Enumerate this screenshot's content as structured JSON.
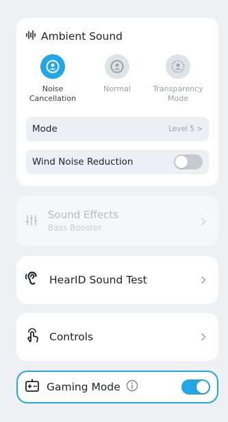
{
  "ambient": {
    "title": "Ambient Sound",
    "icon": "sound-wave-icon",
    "modes": [
      {
        "label": "Noise\nCancellation",
        "icon": "noise-cancellation-icon",
        "active": true
      },
      {
        "label": "Normal",
        "icon": "normal-icon",
        "active": false
      },
      {
        "label": "Transparency\nMode",
        "icon": "transparency-icon",
        "active": false
      }
    ],
    "mode_row": {
      "label": "Mode",
      "value": "Level 5 >"
    },
    "wind_row": {
      "label": "Wind Noise Reduction",
      "enabled": false
    }
  },
  "sound_effects": {
    "title": "Sound Effects",
    "subtitle": "Bass Booster",
    "disabled": true,
    "icon": "equalizer-icon"
  },
  "hearid": {
    "label": "HearID Sound Test",
    "icon": "ear-icon"
  },
  "controls": {
    "label": "Controls",
    "icon": "touch-gesture-icon"
  },
  "gaming": {
    "label": "Gaming Mode",
    "icon": "gamepad-icon",
    "enabled": true
  },
  "colors": {
    "accent": "#22a6e6",
    "background": "#eef0f3",
    "card": "#ffffff",
    "row": "#eceff3",
    "toggle_off": "#c6cbd1"
  }
}
